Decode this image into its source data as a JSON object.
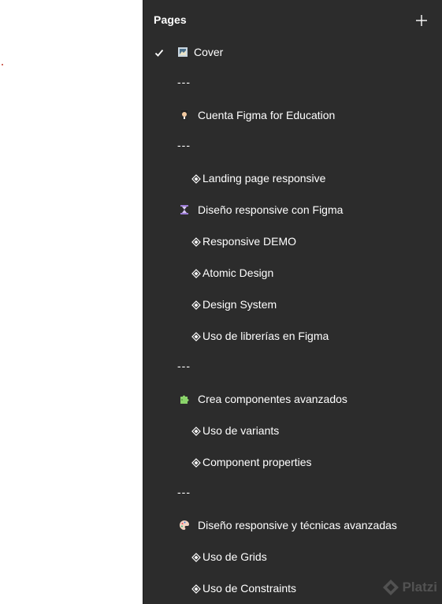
{
  "panel": {
    "title": "Pages",
    "add_icon": "plus-icon"
  },
  "pages": [
    {
      "kind": "cover",
      "label": "Cover",
      "icon": "frame-picture-icon",
      "selected": true
    },
    {
      "kind": "sep",
      "label": "---"
    },
    {
      "kind": "section",
      "label": "Cuenta Figma for Education",
      "icon": "student-icon"
    },
    {
      "kind": "sep",
      "label": "---"
    },
    {
      "kind": "sub",
      "label": "Landing page responsive",
      "icon": "diamond-icon"
    },
    {
      "kind": "section",
      "label": "Diseño responsive con Figma",
      "icon": "hourglass-icon"
    },
    {
      "kind": "sub",
      "label": "Responsive DEMO",
      "icon": "diamond-icon"
    },
    {
      "kind": "sub",
      "label": "Atomic Design",
      "icon": "diamond-icon"
    },
    {
      "kind": "sub",
      "label": "Design System",
      "icon": "diamond-icon"
    },
    {
      "kind": "sub",
      "label": "Uso de librerías en Figma",
      "icon": "diamond-icon"
    },
    {
      "kind": "sep",
      "label": "---"
    },
    {
      "kind": "section",
      "label": "Crea componentes avanzados",
      "icon": "puzzle-icon"
    },
    {
      "kind": "sub",
      "label": "Uso de variants",
      "icon": "diamond-icon"
    },
    {
      "kind": "sub",
      "label": "Component properties",
      "icon": "diamond-icon"
    },
    {
      "kind": "sep",
      "label": "---"
    },
    {
      "kind": "section",
      "label": "Diseño responsive y técnicas avanzadas",
      "icon": "palette-icon"
    },
    {
      "kind": "sub",
      "label": "Uso de Grids",
      "icon": "diamond-icon"
    },
    {
      "kind": "sub",
      "label": "Uso de Constraints",
      "icon": "diamond-icon"
    }
  ],
  "watermark": {
    "text": "Platzi"
  },
  "colors": {
    "panel_bg": "#2c2c2c",
    "text": "#ffffff",
    "canvas_bg": "#ffffff"
  }
}
